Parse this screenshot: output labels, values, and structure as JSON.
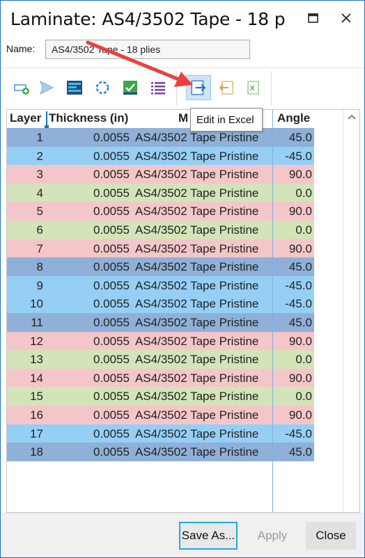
{
  "window": {
    "title": "Laminate: AS4/3502 Tape - 18 p",
    "maximize_icon": "maximize-icon",
    "close_icon": "close-icon"
  },
  "name_field": {
    "label": "Name:",
    "value": "AS4/3502 Tape - 18 plies"
  },
  "toolbar": {
    "buttons": [
      {
        "icon": "add-layer-icon"
      },
      {
        "icon": "send-icon"
      },
      {
        "icon": "layer-stack-icon"
      },
      {
        "icon": "refresh-icon"
      },
      {
        "icon": "check-icon"
      },
      {
        "icon": "list-icon"
      },
      {
        "icon": "edit-in-excel-icon"
      },
      {
        "icon": "import-icon"
      },
      {
        "icon": "excel-icon"
      }
    ],
    "tooltip": "Edit in Excel"
  },
  "grid": {
    "headers": {
      "layer": "Layer",
      "thickness": "Thickness (in)",
      "material": "M",
      "angle": "Angle"
    },
    "colors": {
      "45.0": "#8fb0d8",
      "-45.0": "#95cff5",
      "90.0": "#f5c6c9",
      "0.0": "#d3e4b8"
    },
    "rows": [
      {
        "layer": "1",
        "thickness": "0.0055",
        "material": "AS4/3502 Tape Pristine",
        "angle": "45.0"
      },
      {
        "layer": "2",
        "thickness": "0.0055",
        "material": "AS4/3502 Tape Pristine",
        "angle": "-45.0"
      },
      {
        "layer": "3",
        "thickness": "0.0055",
        "material": "AS4/3502 Tape Pristine",
        "angle": "90.0"
      },
      {
        "layer": "4",
        "thickness": "0.0055",
        "material": "AS4/3502 Tape Pristine",
        "angle": "0.0"
      },
      {
        "layer": "5",
        "thickness": "0.0055",
        "material": "AS4/3502 Tape Pristine",
        "angle": "90.0"
      },
      {
        "layer": "6",
        "thickness": "0.0055",
        "material": "AS4/3502 Tape Pristine",
        "angle": "0.0"
      },
      {
        "layer": "7",
        "thickness": "0.0055",
        "material": "AS4/3502 Tape Pristine",
        "angle": "90.0"
      },
      {
        "layer": "8",
        "thickness": "0.0055",
        "material": "AS4/3502 Tape Pristine",
        "angle": "45.0"
      },
      {
        "layer": "9",
        "thickness": "0.0055",
        "material": "AS4/3502 Tape Pristine",
        "angle": "-45.0"
      },
      {
        "layer": "10",
        "thickness": "0.0055",
        "material": "AS4/3502 Tape Pristine",
        "angle": "-45.0"
      },
      {
        "layer": "11",
        "thickness": "0.0055",
        "material": "AS4/3502 Tape Pristine",
        "angle": "45.0"
      },
      {
        "layer": "12",
        "thickness": "0.0055",
        "material": "AS4/3502 Tape Pristine",
        "angle": "90.0"
      },
      {
        "layer": "13",
        "thickness": "0.0055",
        "material": "AS4/3502 Tape Pristine",
        "angle": "0.0"
      },
      {
        "layer": "14",
        "thickness": "0.0055",
        "material": "AS4/3502 Tape Pristine",
        "angle": "90.0"
      },
      {
        "layer": "15",
        "thickness": "0.0055",
        "material": "AS4/3502 Tape Pristine",
        "angle": "0.0"
      },
      {
        "layer": "16",
        "thickness": "0.0055",
        "material": "AS4/3502 Tape Pristine",
        "angle": "90.0"
      },
      {
        "layer": "17",
        "thickness": "0.0055",
        "material": "AS4/3502 Tape Pristine",
        "angle": "-45.0"
      },
      {
        "layer": "18",
        "thickness": "0.0055",
        "material": "AS4/3502 Tape Pristine",
        "angle": "45.0"
      }
    ]
  },
  "footer": {
    "save_as": "Save As...",
    "apply": "Apply",
    "close": "Close"
  },
  "annotation": {
    "arrow_color": "#e8413c"
  }
}
